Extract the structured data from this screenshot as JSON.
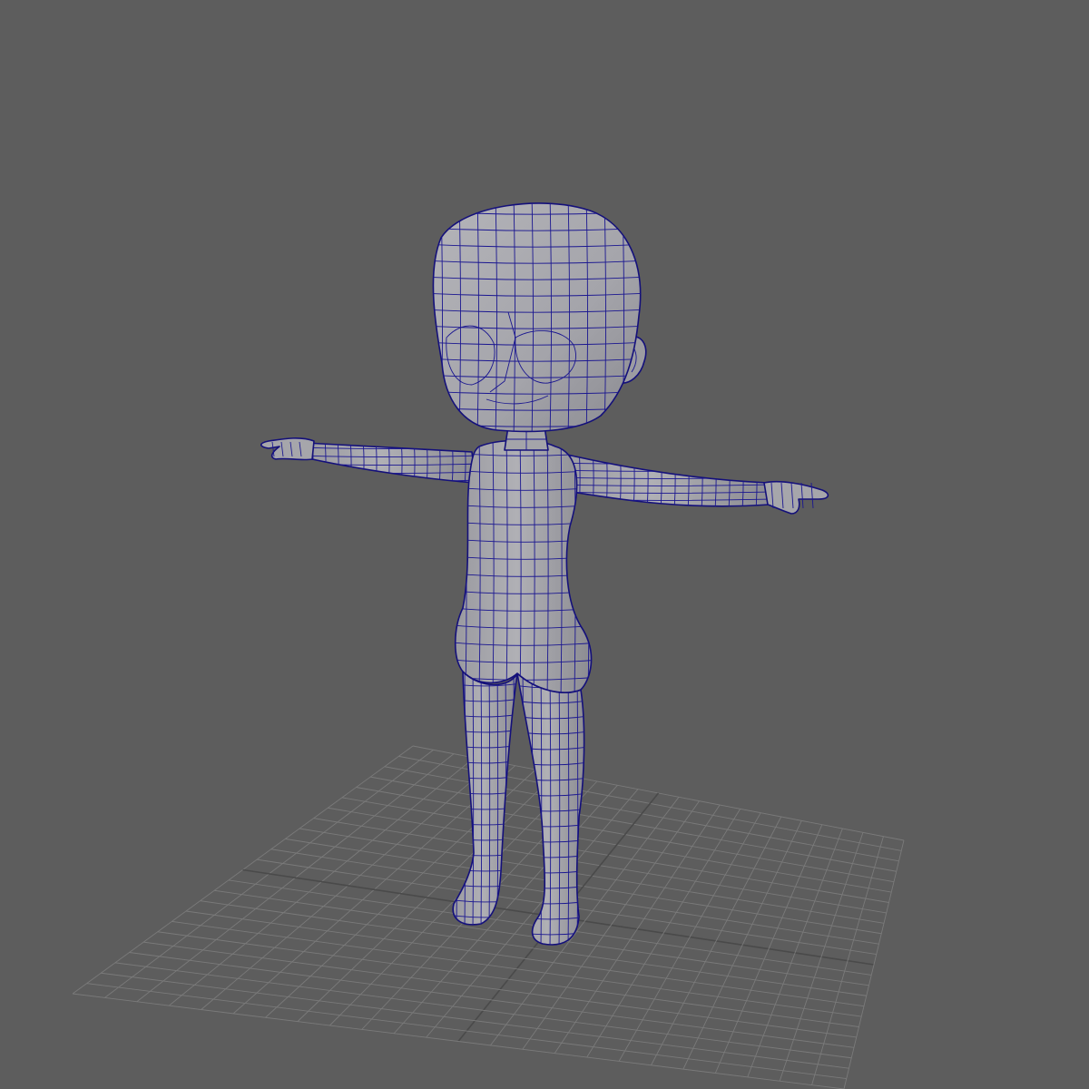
{
  "viewport": {
    "background_color": "#5d5d5d",
    "grid_color": "#7a7a7a",
    "grid_axis_color": "#4a4a4a",
    "mesh_fill_color": "#a9a9ad",
    "mesh_shade_color": "#8e8e94",
    "wireframe_color": "#1a1690",
    "model": "cartoon-character-base-mesh-t-pose",
    "grid_divisions": 24
  }
}
